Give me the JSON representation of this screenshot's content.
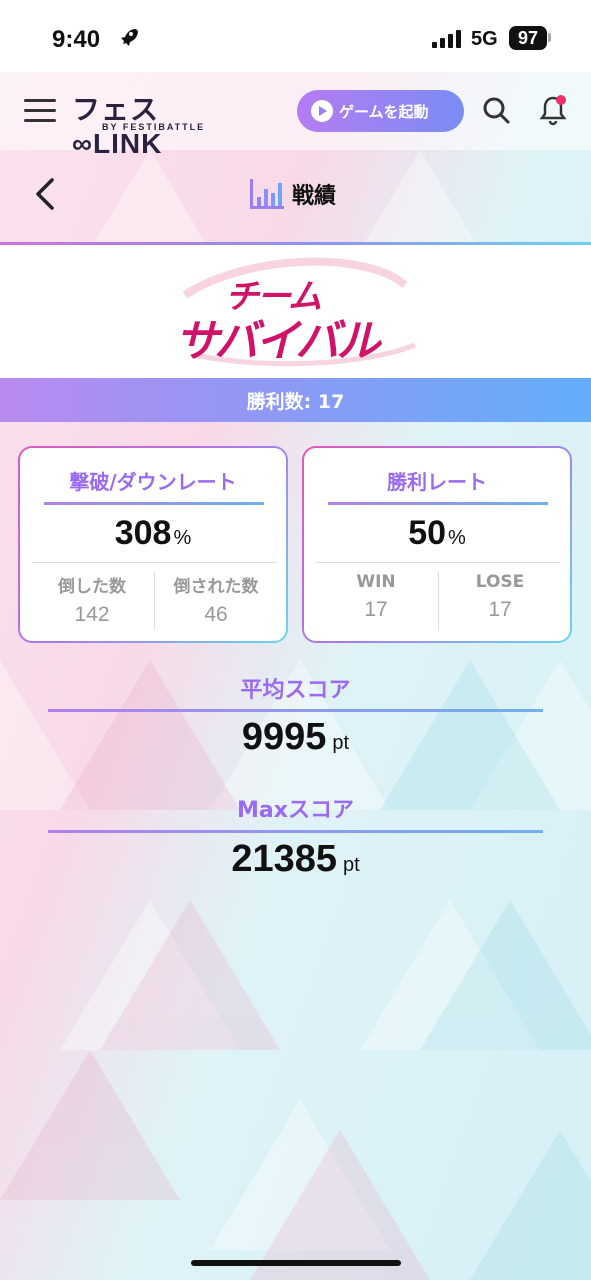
{
  "status_bar": {
    "time": "9:40",
    "network": "5G",
    "battery": "97"
  },
  "header": {
    "logo": "フェス∞LINK",
    "logo_sub": "BY FESTIBATTLE",
    "launch_button": "ゲームを起動"
  },
  "page": {
    "title": "戦績"
  },
  "mode_banner": {
    "line1": "チーム",
    "line2": "サバイバル"
  },
  "wins_bar": "勝利数: 17",
  "kill_card": {
    "title": "撃破/ダウンレート",
    "rate": "308",
    "unit": "%",
    "left_label": "倒した数",
    "left_value": "142",
    "right_label": "倒された数",
    "right_value": "46"
  },
  "win_card": {
    "title": "勝利レート",
    "rate": "50",
    "unit": "%",
    "left_label": "WIN",
    "left_value": "17",
    "right_label": "LOSE",
    "right_value": "17"
  },
  "avg_score": {
    "label": "平均スコア",
    "value": "9995",
    "unit": "pt"
  },
  "max_score": {
    "label": "Maxスコア",
    "value": "21385",
    "unit": "pt"
  },
  "colors": {
    "accent_purple": "#9a6bf0",
    "banner_red": "#d01268",
    "notification": "#f0306a"
  }
}
